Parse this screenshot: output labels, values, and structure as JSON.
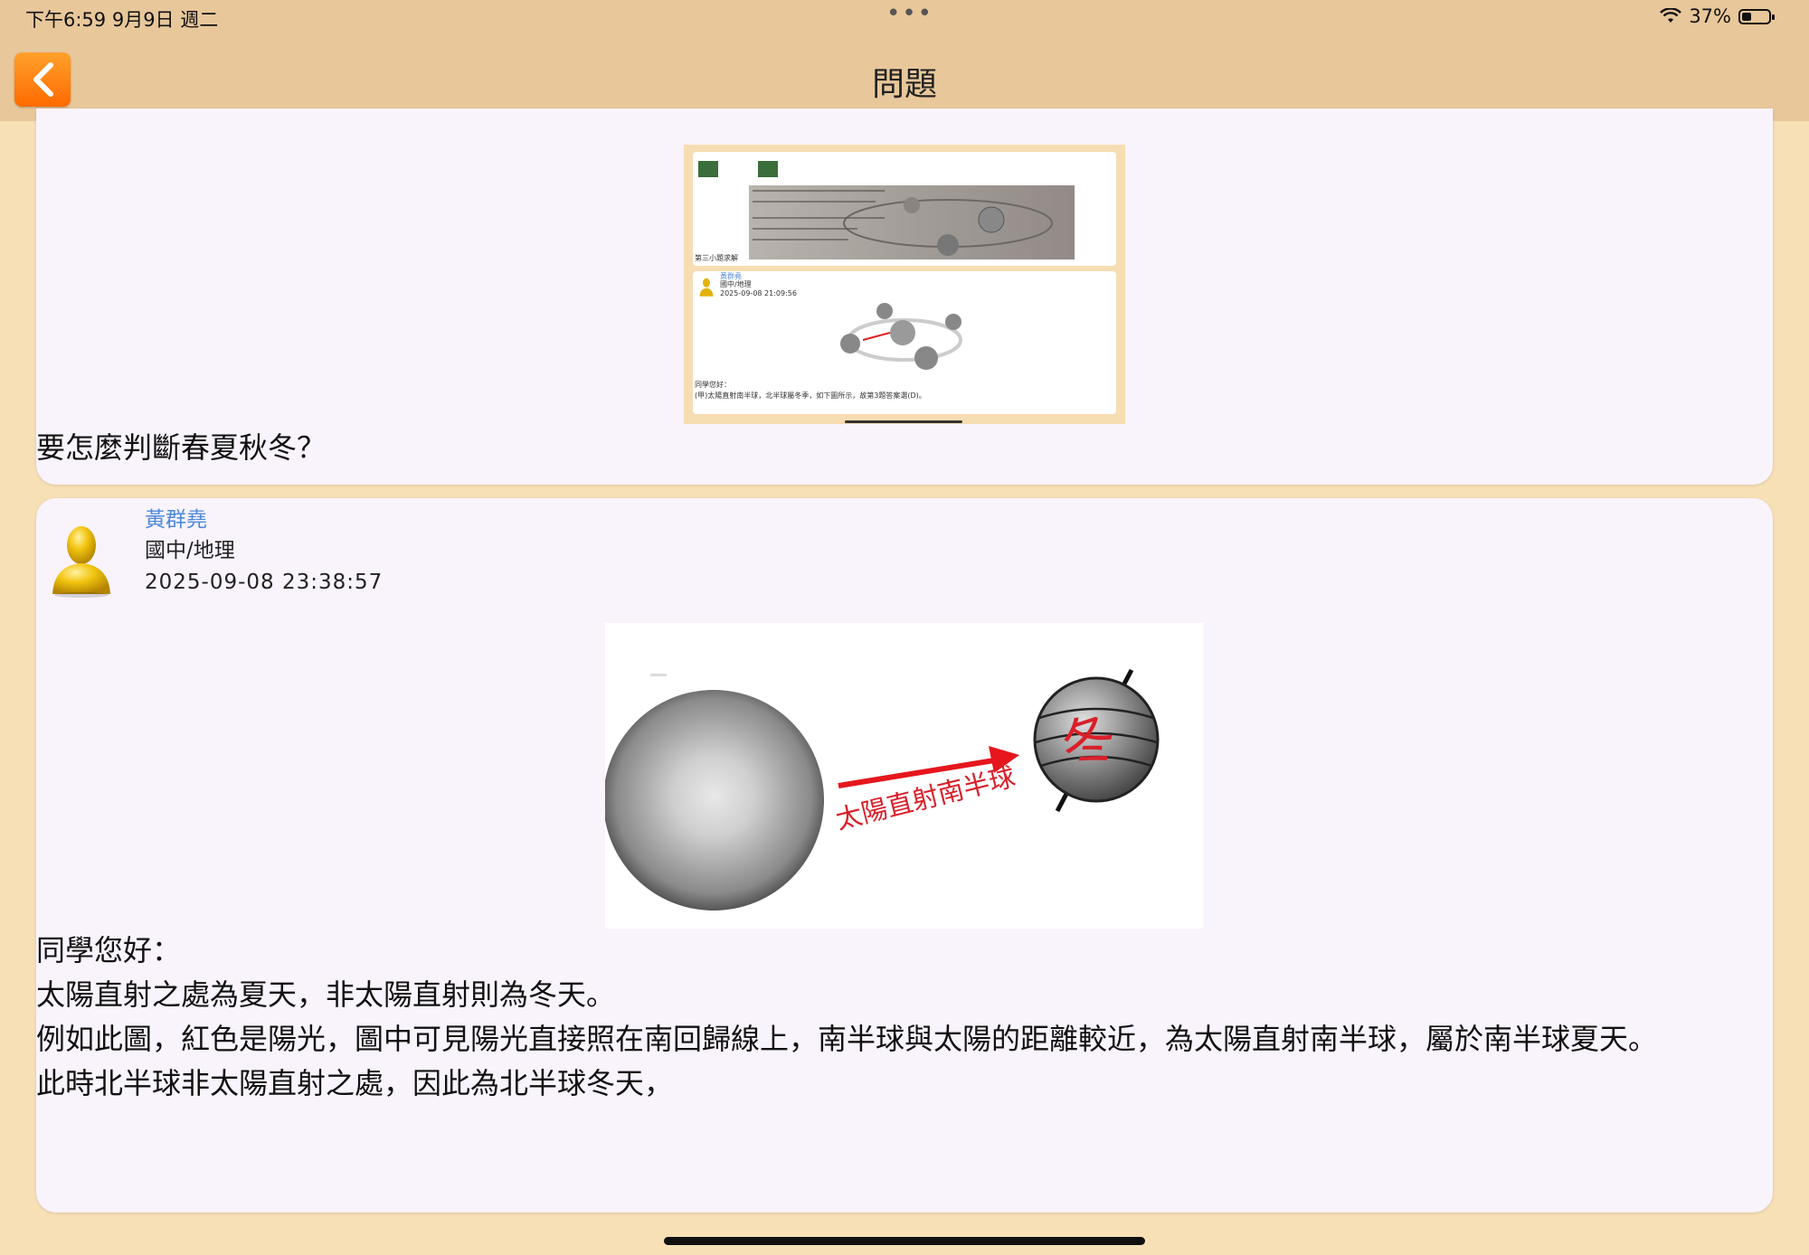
{
  "status_bar": {
    "time_date": "下午6:59   9月9日 週二",
    "dots": "•••",
    "battery_text": "37%",
    "battery_level": 0.37
  },
  "nav": {
    "title": "問題"
  },
  "question_post": {
    "thumbnail": {
      "caption": "第三小題求解",
      "reply_author": "黃群堯",
      "reply_subject": "國中/地理",
      "reply_time": "2025-09-08 21:09:56",
      "reply_line1": "同學您好：",
      "reply_line2": "(甲)太陽直射南半球，北半球屬冬季，如下圖所示，故第3題答案選(D)。"
    },
    "text": "要怎麼判斷春夏秋冬？"
  },
  "reply_post": {
    "author": "黃群堯",
    "subject": "國中/地理",
    "timestamp": "2025-09-08 23:38:57",
    "diagram": {
      "arrow_label": "太陽直射南半球",
      "globe_label": "冬"
    },
    "body": [
      "同學您好：",
      "太陽直射之處為夏天，非太陽直射則為冬天。",
      "例如此圖，紅色是陽光，圖中可見陽光直接照在南回歸線上，南半球與太陽的距離較近，為太陽直射南半球，屬於南半球夏天。",
      "此時北半球非太陽直射之處，因此為北半球冬天，"
    ]
  },
  "colors": {
    "nav_bg": "#e8c79a",
    "page_bg": "#f7e0b6",
    "card_bg": "#f9f3fc",
    "accent": "#ff7a00",
    "author": "#4e8ad8"
  }
}
